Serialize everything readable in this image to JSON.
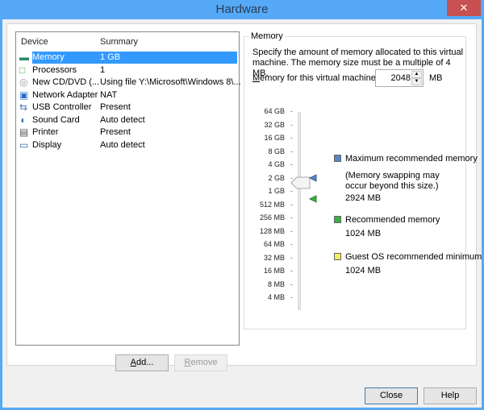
{
  "window": {
    "title": "Hardware",
    "close_glyph": "✕"
  },
  "device_list": {
    "headers": {
      "device": "Device",
      "summary": "Summary"
    },
    "rows": [
      {
        "name": "Memory",
        "summary": "1 GB",
        "icon": "memory-icon",
        "selected": true
      },
      {
        "name": "Processors",
        "summary": "1",
        "icon": "processor-icon"
      },
      {
        "name": "New CD/DVD (...",
        "summary": "Using file Y:\\Microsoft\\Windows 8\\...",
        "icon": "cd-dvd-icon"
      },
      {
        "name": "Network Adapter",
        "summary": "NAT",
        "icon": "network-adapter-icon"
      },
      {
        "name": "USB Controller",
        "summary": "Present",
        "icon": "usb-icon"
      },
      {
        "name": "Sound Card",
        "summary": "Auto detect",
        "icon": "sound-card-icon"
      },
      {
        "name": "Printer",
        "summary": "Present",
        "icon": "printer-icon"
      },
      {
        "name": "Display",
        "summary": "Auto detect",
        "icon": "display-icon"
      }
    ]
  },
  "buttons": {
    "add_prefix": "A",
    "add_rest": "dd...",
    "remove_prefix": "R",
    "remove_rest": "emove",
    "close": "Close",
    "help": "Help"
  },
  "memory": {
    "group_title": "Memory",
    "description": "Specify the amount of memory allocated to this virtual machine. The memory size must be a multiple of 4 MB.",
    "label_prefix": "M",
    "label_rest": "emory for this virtual machine:",
    "value": "2048",
    "unit": "MB",
    "scale": [
      "64 GB",
      "32 GB",
      "16 GB",
      "8 GB",
      "4 GB",
      "2 GB",
      "1 GB",
      "512 MB",
      "256 MB",
      "128 MB",
      "64 MB",
      "32 MB",
      "16 MB",
      "8 MB",
      "4 MB"
    ],
    "legend": {
      "max": {
        "label": "Maximum recommended memory",
        "note": "(Memory swapping may occur beyond this size.)",
        "value": "2924 MB",
        "color": "#5b86c0"
      },
      "recommended": {
        "label": "Recommended memory",
        "value": "1024 MB",
        "color": "#3cb043"
      },
      "guest_min": {
        "label": "Guest OS recommended minimum",
        "value": "1024 MB",
        "color": "#f2ee5c"
      }
    }
  }
}
